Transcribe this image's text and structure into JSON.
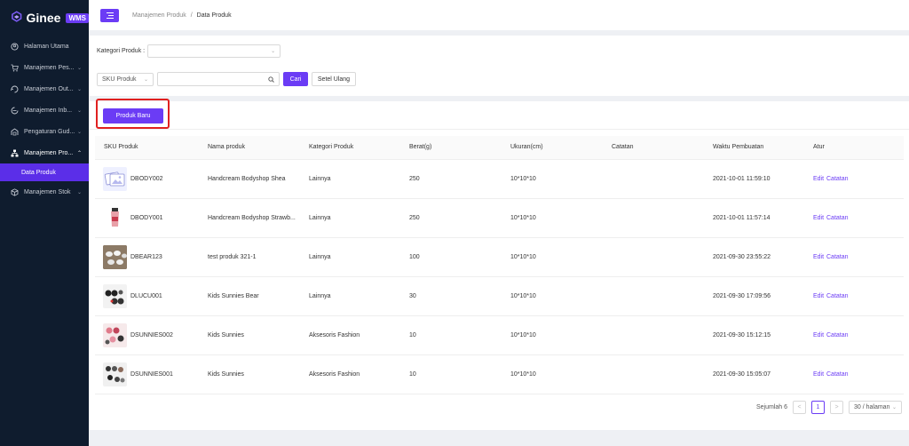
{
  "brand": {
    "name": "Ginee",
    "badge": "WMS",
    "accent": "#6b3cf5"
  },
  "sidebar": {
    "items": [
      {
        "label": "Halaman Utama",
        "icon": "home-icon"
      },
      {
        "label": "Manajemen Pes...",
        "icon": "cart-icon"
      },
      {
        "label": "Manajemen Out...",
        "icon": "outbound-icon"
      },
      {
        "label": "Manajemen Inb...",
        "icon": "inbound-icon"
      },
      {
        "label": "Pengaturan Gud...",
        "icon": "warehouse-icon"
      },
      {
        "label": "Manajemen Pro...",
        "icon": "product-icon"
      },
      {
        "label": "Data Produk",
        "icon": ""
      },
      {
        "label": "Manajemen Stok",
        "icon": "box-icon"
      }
    ]
  },
  "breadcrumb": {
    "parent": "Manajemen Produk",
    "separator": "/",
    "current": "Data Produk"
  },
  "filter": {
    "category_label": "Kategori Produk :",
    "category_value": "",
    "sku_select": "SKU Produk",
    "search_value": "",
    "search_button": "Cari",
    "reset_button": "Setel Ulang"
  },
  "toolbar": {
    "new_button": "Produk Baru"
  },
  "table": {
    "headers": [
      "SKU Produk",
      "Nama produk",
      "Kategori Produk",
      "Berat(g)",
      "Ukuran(cm)",
      "Catatan",
      "Waktu Pembuatan",
      "Atur"
    ],
    "rows": [
      {
        "sku": "DBODY002",
        "name": "Handcream Bodyshop Shea",
        "category": "Lainnya",
        "weight": "250",
        "size": "10*10*10",
        "note": "",
        "created": "2021-10-01 11:59:10",
        "edit": "Edit",
        "notes_link": "Catatan",
        "thumb": "placeholder"
      },
      {
        "sku": "DBODY001",
        "name": "Handcream Bodyshop Strawb...",
        "category": "Lainnya",
        "weight": "250",
        "size": "10*10*10",
        "note": "",
        "created": "2021-10-01 11:57:14",
        "edit": "Edit",
        "notes_link": "Catatan",
        "thumb": "tube"
      },
      {
        "sku": "DBEAR123",
        "name": "test produk 321-1",
        "category": "Lainnya",
        "weight": "100",
        "size": "10*10*10",
        "note": "",
        "created": "2021-09-30 23:55:22",
        "edit": "Edit",
        "notes_link": "Catatan",
        "thumb": "jars"
      },
      {
        "sku": "DLUCU001",
        "name": "Kids Sunnies Bear",
        "category": "Lainnya",
        "weight": "30",
        "size": "10*10*10",
        "note": "",
        "created": "2021-09-30 17:09:56",
        "edit": "Edit",
        "notes_link": "Catatan",
        "thumb": "sunnies-dark"
      },
      {
        "sku": "DSUNNIES002",
        "name": "Kids Sunnies",
        "category": "Aksesoris Fashion",
        "weight": "10",
        "size": "10*10*10",
        "note": "",
        "created": "2021-09-30 15:12:15",
        "edit": "Edit",
        "notes_link": "Catatan",
        "thumb": "sunnies-pink"
      },
      {
        "sku": "DSUNNIES001",
        "name": "Kids Sunnies",
        "category": "Aksesoris Fashion",
        "weight": "10",
        "size": "10*10*10",
        "note": "",
        "created": "2021-09-30 15:05:07",
        "edit": "Edit",
        "notes_link": "Catatan",
        "thumb": "sunnies-mixed"
      }
    ]
  },
  "pagination": {
    "total": "Sejumlah 6",
    "prev": "<",
    "page": "1",
    "next": ">",
    "page_size": "30 / halaman"
  }
}
